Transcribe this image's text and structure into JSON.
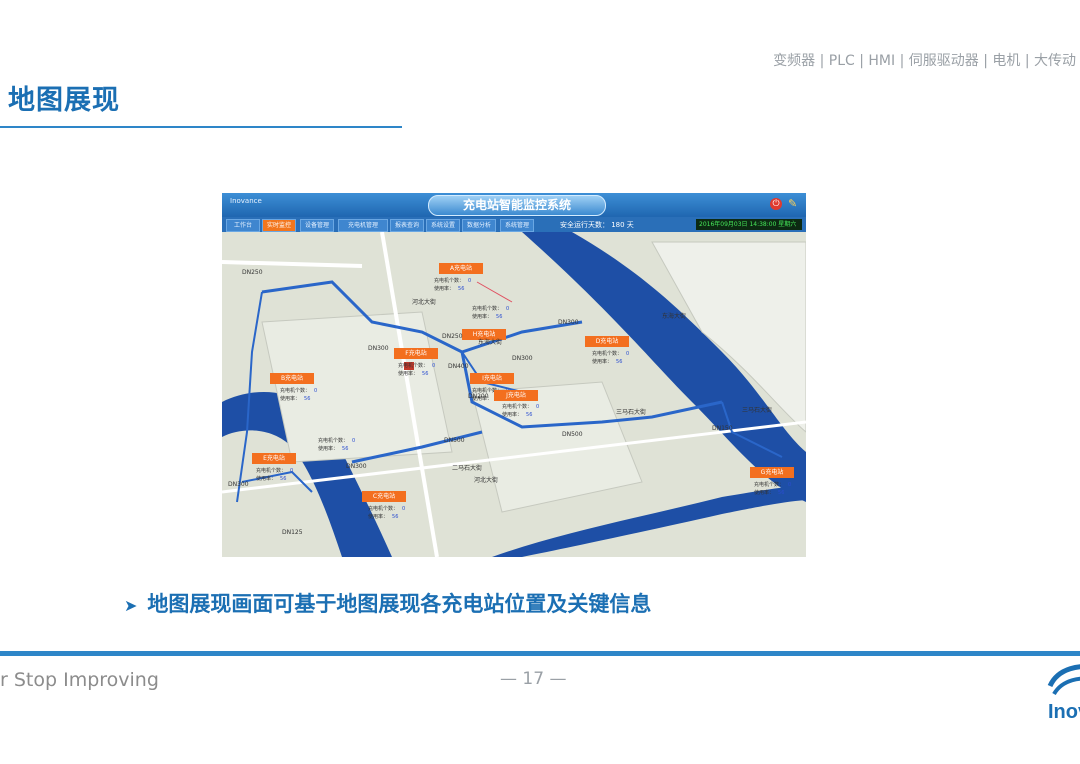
{
  "header": {
    "product_line": "变频器 | PLC | HMI | 伺服驱动器 | 电机 | 大传动",
    "title": "地图展现"
  },
  "bullet": "地图展现画面可基于地图展现各充电站位置及关键信息",
  "footer": {
    "slogan": "r Stop Improving",
    "page_number": "— 17 —",
    "logo_text": "Inov"
  },
  "colors": {
    "accent": "#1b6fb3",
    "rule": "#2e86c8",
    "station": "#f36f1f",
    "river": "#1e4fa6",
    "pipe": "#2a66c9"
  },
  "screenshot": {
    "app_title": "充电站智能监控系统",
    "logo_text": "Inovance",
    "tabs": [
      "工作台",
      "实时监控",
      "设备管理",
      "充电机管理",
      "报表查询",
      "系统设置",
      "数据分析",
      "系统管理"
    ],
    "active_tab": 1,
    "run_days_label": "安全运行天数：  180  天",
    "clock": "2016年09月03日    14:38:00    星期六",
    "stations": [
      {
        "name": "A充电站",
        "count_label": "充电机个数：",
        "count": "0",
        "rate_label": "使用率：",
        "rate": "56"
      },
      {
        "name": "B充电站",
        "count_label": "充电机个数：",
        "count": "0",
        "rate_label": "使用率：",
        "rate": "56"
      },
      {
        "name": "C充电站",
        "count_label": "充电机个数：",
        "count": "0",
        "rate_label": "使用率：",
        "rate": "56"
      },
      {
        "name": "D充电站",
        "count_label": "充电机个数：",
        "count": "0",
        "rate_label": "使用率：",
        "rate": "56"
      },
      {
        "name": "E充电站",
        "count_label": "充电机个数：",
        "count": "0",
        "rate_label": "使用率：",
        "rate": "56"
      },
      {
        "name": "F充电站",
        "count_label": "充电机个数：",
        "count": "0",
        "rate_label": "使用率：",
        "rate": "56"
      },
      {
        "name": "G充电站",
        "count_label": "充电机个数：",
        "count": "0",
        "rate_label": "使用率：",
        "rate": "56"
      },
      {
        "name": "H充电站",
        "count_label": "充电机个数：",
        "count": "0",
        "rate_label": "使用率：",
        "rate": "56"
      },
      {
        "name": "I充电站",
        "count_label": "充电机个数：",
        "count": "0",
        "rate_label": "使用率：",
        "rate": "56"
      },
      {
        "name": "J充电站",
        "count_label": "充电机个数：",
        "count": "0",
        "rate_label": "使用率：",
        "rate": "56"
      }
    ],
    "pipes": [
      "DN250",
      "DN300",
      "DN400",
      "DN200",
      "DN500",
      "DN300",
      "DN300",
      "DN500",
      "DN150",
      "DN300",
      "DN125",
      "DN250",
      "DN300"
    ],
    "roads": [
      "东海大街",
      "东海大街",
      "二马石大街",
      "三马石大街",
      "三马石大街",
      "河北大街",
      "河北大街"
    ],
    "free_info": {
      "count_label": "充电机个数：",
      "count": "0",
      "rate_label": "使用率：",
      "rate": "56"
    }
  }
}
